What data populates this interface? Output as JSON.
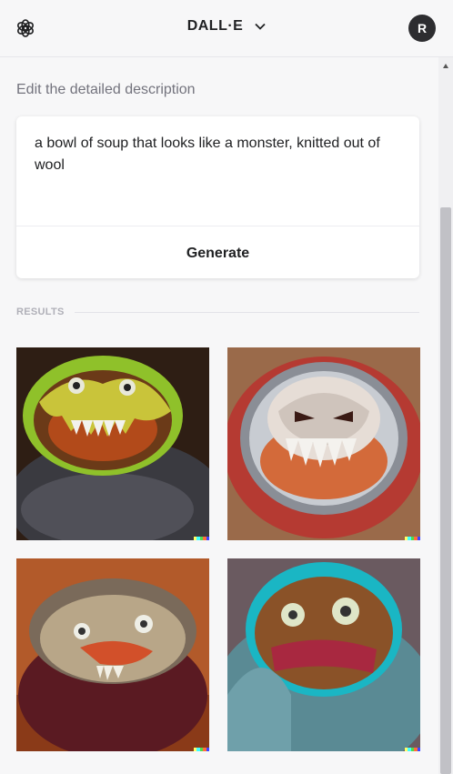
{
  "header": {
    "title": "DALL·E",
    "avatar_initial": "R"
  },
  "icons": {
    "logo": "openai-logo-icon",
    "dropdown": "chevron-down-icon"
  },
  "editor": {
    "label": "Edit the detailed description",
    "prompt": "a bowl of soup that looks like a monster, knitted out of wool",
    "generate_label": "Generate"
  },
  "results": {
    "label": "RESULTS",
    "images": [
      {
        "name": "result-image-1",
        "subject": "green bowl knitted soup monster on dark knit"
      },
      {
        "name": "result-image-2",
        "subject": "grey bowl knitted soup monster on red knit"
      },
      {
        "name": "result-image-3",
        "subject": "soup monster in maroon knit sleeve"
      },
      {
        "name": "result-image-4",
        "subject": "teal bowl soup monster in blue knit"
      }
    ]
  },
  "colors": {
    "background": "#f7f7f8",
    "text": "#202123",
    "muted": "#73737d"
  },
  "signature_colors": [
    "#ffff66",
    "#42ffff",
    "#51da4c",
    "#ff6e3c",
    "#3c46ff"
  ]
}
